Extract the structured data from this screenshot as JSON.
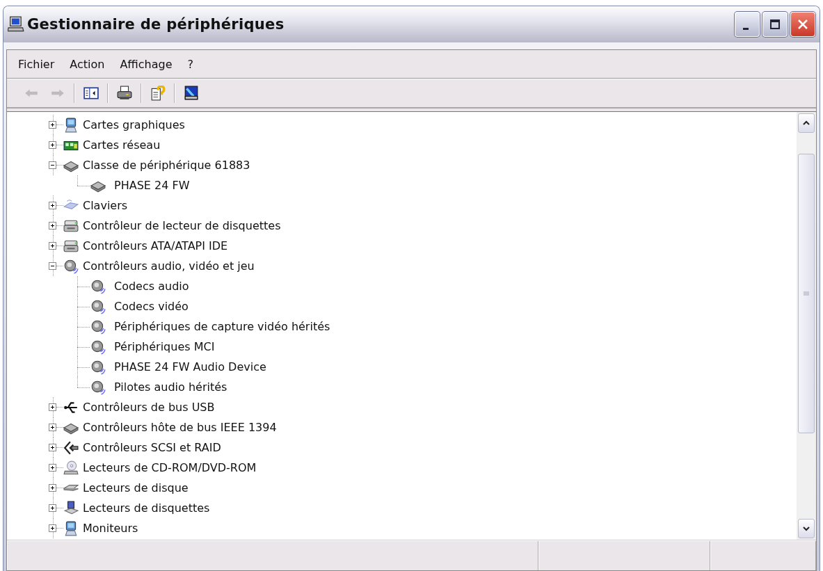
{
  "window": {
    "title": "Gestionnaire de périphériques"
  },
  "menu": [
    "Fichier",
    "Action",
    "Affichage",
    "?"
  ],
  "toolbar": [
    {
      "kind": "back",
      "disabled": true
    },
    {
      "kind": "forward",
      "disabled": true
    },
    {
      "kind": "sep"
    },
    {
      "kind": "panel",
      "disabled": false
    },
    {
      "kind": "sep"
    },
    {
      "kind": "print",
      "disabled": false
    },
    {
      "kind": "sep"
    },
    {
      "kind": "help",
      "disabled": false
    },
    {
      "kind": "sep"
    },
    {
      "kind": "scan",
      "disabled": false
    }
  ],
  "tree": [
    {
      "label": "Cartes graphiques",
      "kind": "display",
      "expanded": false
    },
    {
      "label": "Cartes réseau",
      "kind": "network",
      "expanded": false
    },
    {
      "label": "Classe de périphérique 61883",
      "kind": "device",
      "expanded": true,
      "children": [
        {
          "label": "PHASE 24 FW",
          "kind": "device"
        }
      ]
    },
    {
      "label": "Claviers",
      "kind": "keyboard",
      "expanded": false
    },
    {
      "label": "Contrôleur de lecteur de disquettes",
      "kind": "controller",
      "expanded": false
    },
    {
      "label": "Contrôleurs ATA/ATAPI IDE",
      "kind": "controller",
      "expanded": false
    },
    {
      "label": "Contrôleurs audio, vidéo et jeu",
      "kind": "speaker",
      "expanded": true,
      "children": [
        {
          "label": "Codecs audio",
          "kind": "speaker"
        },
        {
          "label": "Codecs vidéo",
          "kind": "speaker"
        },
        {
          "label": "Périphériques de capture vidéo hérités",
          "kind": "speaker"
        },
        {
          "label": "Périphériques MCI",
          "kind": "speaker"
        },
        {
          "label": "PHASE 24 FW Audio Device",
          "kind": "speaker"
        },
        {
          "label": "Pilotes audio hérités",
          "kind": "speaker"
        }
      ]
    },
    {
      "label": "Contrôleurs de bus USB",
      "kind": "usb",
      "expanded": false
    },
    {
      "label": "Contrôleurs hôte de bus IEEE 1394",
      "kind": "device",
      "expanded": false
    },
    {
      "label": "Contrôleurs SCSI et RAID",
      "kind": "scsi",
      "expanded": false
    },
    {
      "label": "Lecteurs de CD-ROM/DVD-ROM",
      "kind": "cdrom",
      "expanded": false
    },
    {
      "label": "Lecteurs de disque",
      "kind": "disk",
      "expanded": false
    },
    {
      "label": "Lecteurs de disquettes",
      "kind": "floppy",
      "expanded": false
    },
    {
      "label": "Moniteurs",
      "kind": "display",
      "expanded": false
    }
  ]
}
